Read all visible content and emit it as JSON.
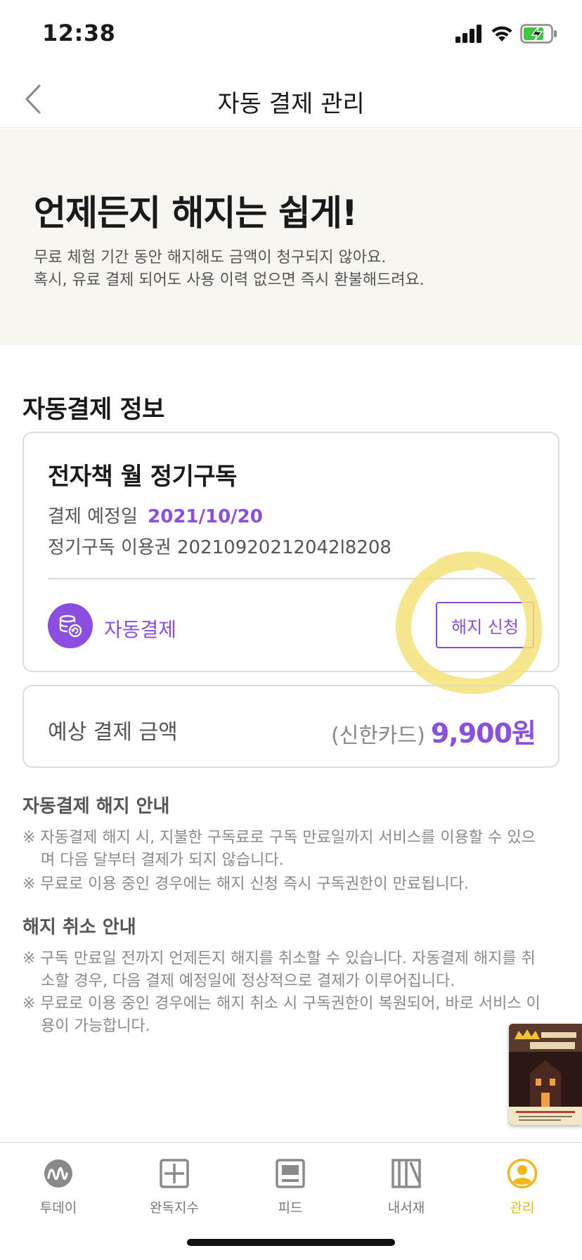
{
  "status_bar": {
    "time": "12:38"
  },
  "nav": {
    "title": "자동 결제 관리"
  },
  "hero": {
    "title": "언제든지 해지는 쉽게!",
    "desc_line1": "무료 체험 기간 동안 해지해도 금액이 청구되지 않아요.",
    "desc_line2": "혹시, 유료 결제 되어도 사용 이력 없으면 즉시 환불해드려요."
  },
  "auto_pay_info": {
    "section_title": "자동결제 정보",
    "product_name": "전자책 월 정기구독",
    "pay_date_label": "결제 예정일",
    "pay_date_value": "2021/10/20",
    "ticket_label": "정기구독 이용권",
    "ticket_number": "20210920212042l8208",
    "auto_pay_label": "자동결제",
    "cancel_button": "해지 신청"
  },
  "amount": {
    "label": "예상 결제 금액",
    "card_name": "(신한카드)",
    "value": "9,900원"
  },
  "notice_cancel": {
    "title": "자동결제 해지 안내",
    "items": [
      "※ 자동결제 해지 시, 지불한 구독료로 구독 만료일까지 서비스를 이용할 수 있으며 다음 달부터 결제가 되지 않습니다.",
      "※ 무료로 이용 중인 경우에는 해지 신청 즉시 구독권한이 만료됩니다."
    ]
  },
  "notice_revoke": {
    "title": "해지 취소 안내",
    "items": [
      "※ 구독 만료일 전까지 언제든지 해지를 취소할 수 있습니다. 자동결제 해지를 취소할 경우, 다음 결제 예정일에 정상적으로 결제가 이루어집니다.",
      "※ 무료로 이용 중인 경우에는 해지 취소 시 구독권한이 복원되어, 바로 서비스 이용이 가능합니다."
    ]
  },
  "tabs": [
    {
      "label": "투데이",
      "icon": "today-icon"
    },
    {
      "label": "완독지수",
      "icon": "completion-icon"
    },
    {
      "label": "피드",
      "icon": "feed-icon"
    },
    {
      "label": "내서재",
      "icon": "library-icon"
    },
    {
      "label": "관리",
      "icon": "profile-icon",
      "active": true
    }
  ],
  "colors": {
    "accent": "#8a4ee0",
    "active_tab": "#f3b71e",
    "highlight": "#f5e27a",
    "hero_bg": "#f8f6f1"
  }
}
